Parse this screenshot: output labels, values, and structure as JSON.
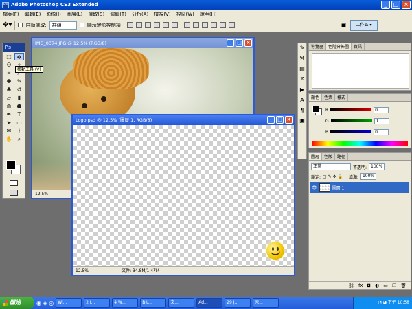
{
  "app": {
    "title": "Adobe Photoshop CS3 Extended"
  },
  "menu": [
    "檔案(F)",
    "編輯(E)",
    "影像(I)",
    "圖層(L)",
    "選取(S)",
    "濾鏡(T)",
    "分析(A)",
    "檢視(V)",
    "視窗(W)",
    "說明(H)"
  ],
  "options": {
    "auto_select_label": "自動選取:",
    "auto_select_value": "群組",
    "show_transform_label": "顯示變形控制項",
    "workspace_label": "工作區"
  },
  "tooltip": "移動工具 (V)",
  "doc1": {
    "title": "IMG_0374.JPG @ 12.5% (RGB/8)",
    "zoom": "12.5%"
  },
  "doc2": {
    "title": "Logo.psd @ 12.5% (圖層 1, RGB/8)",
    "zoom": "12.5%",
    "doc_size": "文件: 34.8M/1.47M"
  },
  "nav_panel": {
    "tabs": [
      "導覽器",
      "色階分佈圖",
      "資訊"
    ]
  },
  "color_panel": {
    "tabs": [
      "顏色",
      "色票",
      "樣式"
    ],
    "channels": [
      {
        "name": "R",
        "value": "0",
        "color": "#d40000"
      },
      {
        "name": "G",
        "value": "0",
        "color": "#00a000"
      },
      {
        "name": "B",
        "value": "0",
        "color": "#0000d0"
      }
    ]
  },
  "layers_panel": {
    "tabs": [
      "圖層",
      "色版",
      "路徑"
    ],
    "blend_mode": "正常",
    "opacity_label": "不透明:",
    "opacity_value": "100%",
    "lock_label": "鎖定:",
    "fill_label": "填滿:",
    "fill_value": "100%",
    "layer_name": "圖層 1"
  },
  "taskbar": {
    "start_label": "開始",
    "items": [
      "Wi...",
      "2 I...",
      "4 W...",
      "Bit...",
      "文...",
      "Ad...",
      "29 J...",
      "未..."
    ],
    "clock": "下午 10:58"
  }
}
